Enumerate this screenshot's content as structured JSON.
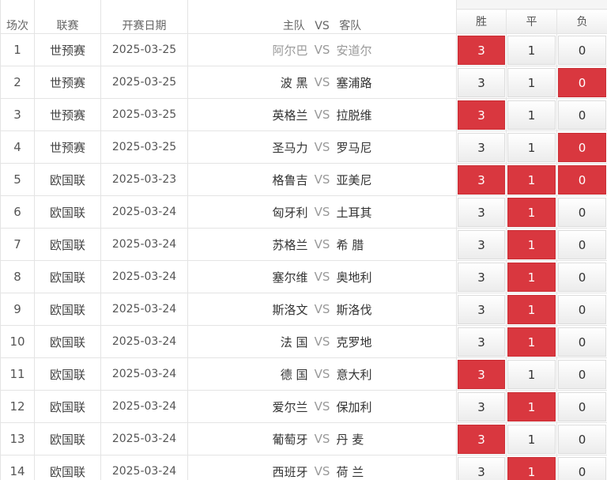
{
  "header": {
    "col_no": "场次",
    "col_league": "联赛",
    "col_date": "开赛日期",
    "col_match_home": "主队",
    "col_match_vs": "VS",
    "col_match_away": "客队",
    "col_win": "胜",
    "col_draw": "平",
    "col_lose": "负"
  },
  "colors": {
    "selected": "#d9373f",
    "dim_text": "#999999"
  },
  "rows": [
    {
      "no": "1",
      "league": "世预赛",
      "date": "2025-03-25",
      "home": "阿尔巴",
      "vs": "VS",
      "away": "安道尔",
      "win": "3",
      "draw": "1",
      "lose": "0",
      "sel_win": true,
      "sel_draw": false,
      "sel_lose": false,
      "dim": true
    },
    {
      "no": "2",
      "league": "世预赛",
      "date": "2025-03-25",
      "home": "波 黑",
      "vs": "VS",
      "away": "塞浦路",
      "win": "3",
      "draw": "1",
      "lose": "0",
      "sel_win": false,
      "sel_draw": false,
      "sel_lose": true,
      "dim": false
    },
    {
      "no": "3",
      "league": "世预赛",
      "date": "2025-03-25",
      "home": "英格兰",
      "vs": "VS",
      "away": "拉脱维",
      "win": "3",
      "draw": "1",
      "lose": "0",
      "sel_win": true,
      "sel_draw": false,
      "sel_lose": false,
      "dim": false
    },
    {
      "no": "4",
      "league": "世预赛",
      "date": "2025-03-25",
      "home": "圣马力",
      "vs": "VS",
      "away": "罗马尼",
      "win": "3",
      "draw": "1",
      "lose": "0",
      "sel_win": false,
      "sel_draw": false,
      "sel_lose": true,
      "dim": false
    },
    {
      "no": "5",
      "league": "欧国联",
      "date": "2025-03-23",
      "home": "格鲁吉",
      "vs": "VS",
      "away": "亚美尼",
      "win": "3",
      "draw": "1",
      "lose": "0",
      "sel_win": true,
      "sel_draw": true,
      "sel_lose": true,
      "dim": false
    },
    {
      "no": "6",
      "league": "欧国联",
      "date": "2025-03-24",
      "home": "匈牙利",
      "vs": "VS",
      "away": "土耳其",
      "win": "3",
      "draw": "1",
      "lose": "0",
      "sel_win": false,
      "sel_draw": true,
      "sel_lose": false,
      "dim": false
    },
    {
      "no": "7",
      "league": "欧国联",
      "date": "2025-03-24",
      "home": "苏格兰",
      "vs": "VS",
      "away": "希 腊",
      "win": "3",
      "draw": "1",
      "lose": "0",
      "sel_win": false,
      "sel_draw": true,
      "sel_lose": false,
      "dim": false
    },
    {
      "no": "8",
      "league": "欧国联",
      "date": "2025-03-24",
      "home": "塞尔维",
      "vs": "VS",
      "away": "奥地利",
      "win": "3",
      "draw": "1",
      "lose": "0",
      "sel_win": false,
      "sel_draw": true,
      "sel_lose": false,
      "dim": false
    },
    {
      "no": "9",
      "league": "欧国联",
      "date": "2025-03-24",
      "home": "斯洛文",
      "vs": "VS",
      "away": "斯洛伐",
      "win": "3",
      "draw": "1",
      "lose": "0",
      "sel_win": false,
      "sel_draw": true,
      "sel_lose": false,
      "dim": false
    },
    {
      "no": "10",
      "league": "欧国联",
      "date": "2025-03-24",
      "home": "法 国",
      "vs": "VS",
      "away": "克罗地",
      "win": "3",
      "draw": "1",
      "lose": "0",
      "sel_win": false,
      "sel_draw": true,
      "sel_lose": false,
      "dim": false
    },
    {
      "no": "11",
      "league": "欧国联",
      "date": "2025-03-24",
      "home": "德 国",
      "vs": "VS",
      "away": "意大利",
      "win": "3",
      "draw": "1",
      "lose": "0",
      "sel_win": true,
      "sel_draw": false,
      "sel_lose": false,
      "dim": false
    },
    {
      "no": "12",
      "league": "欧国联",
      "date": "2025-03-24",
      "home": "爱尔兰",
      "vs": "VS",
      "away": "保加利",
      "win": "3",
      "draw": "1",
      "lose": "0",
      "sel_win": false,
      "sel_draw": true,
      "sel_lose": false,
      "dim": false
    },
    {
      "no": "13",
      "league": "欧国联",
      "date": "2025-03-24",
      "home": "葡萄牙",
      "vs": "VS",
      "away": "丹 麦",
      "win": "3",
      "draw": "1",
      "lose": "0",
      "sel_win": true,
      "sel_draw": false,
      "sel_lose": false,
      "dim": false
    },
    {
      "no": "14",
      "league": "欧国联",
      "date": "2025-03-24",
      "home": "西班牙",
      "vs": "VS",
      "away": "荷 兰",
      "win": "3",
      "draw": "1",
      "lose": "0",
      "sel_win": false,
      "sel_draw": true,
      "sel_lose": false,
      "dim": false
    }
  ]
}
